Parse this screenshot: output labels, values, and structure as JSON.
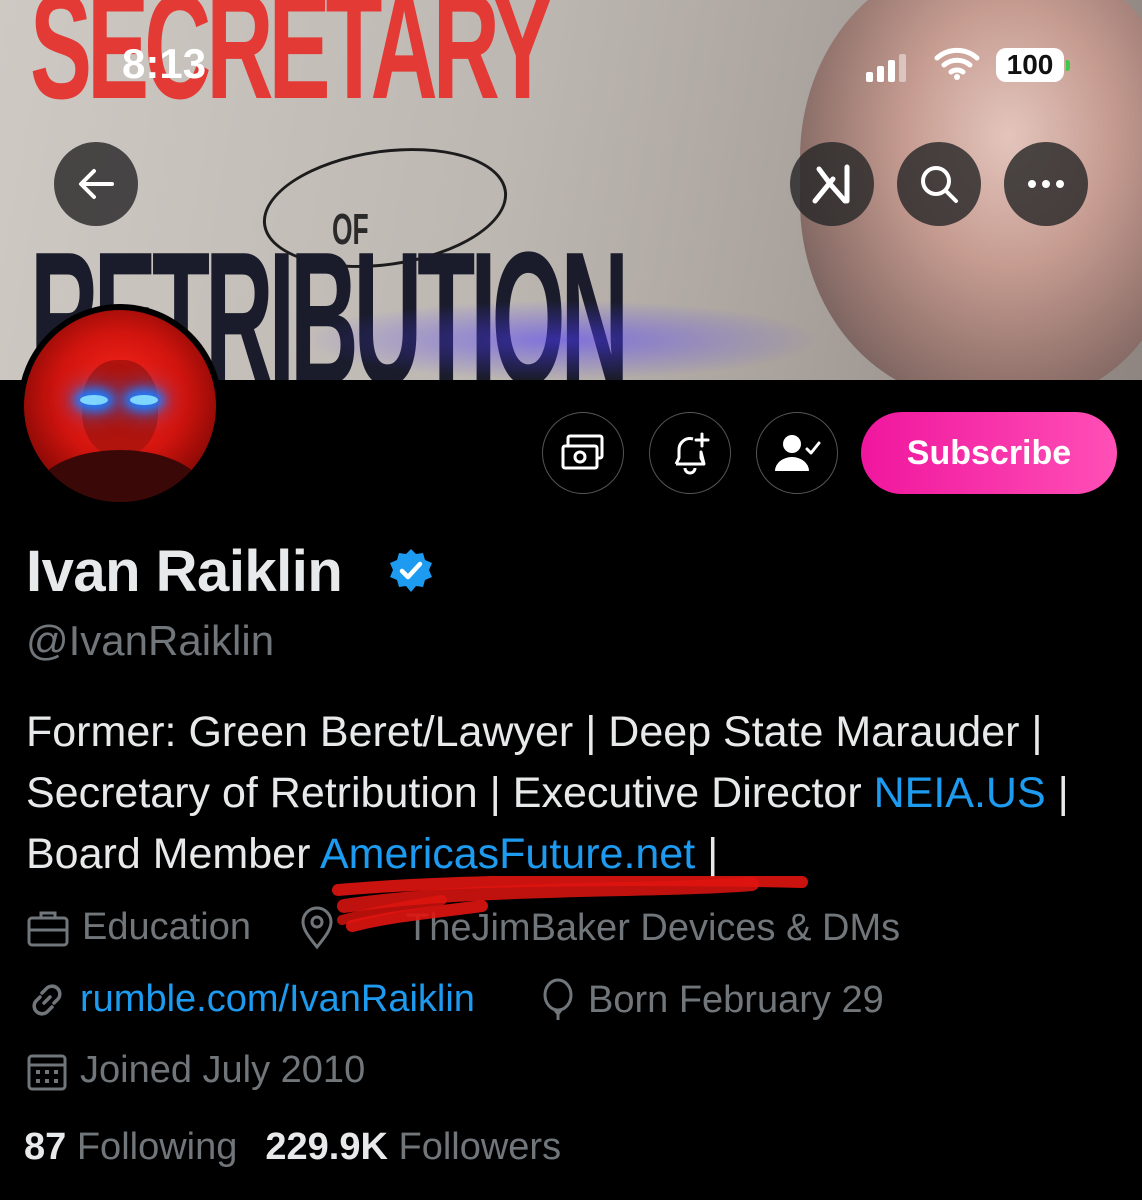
{
  "status_bar": {
    "time": "8:13",
    "battery": "100"
  },
  "banner": {
    "text_line1": "SECRETARY",
    "text_line2": "OF",
    "text_line3": "RETRIBUTION"
  },
  "profile": {
    "name": "Ivan Raiklin",
    "handle": "@IvanRaiklin",
    "subscribe_label": "Subscribe",
    "bio": {
      "line1": "Former: Green Beret/Lawyer | Deep State Marauder |",
      "line2_pre": "Secretary of Retribution | Executive Director ",
      "line2_link": "NEIA.US",
      "line2_post": " |",
      "line3_pre": "Board Member ",
      "line3_link": "AmericasFuture.net",
      "line3_post": " |"
    },
    "category": "Education",
    "location": "TheJimBaker Devices & DMs",
    "website": "rumble.com/IvanRaiklin",
    "birthday": "Born February 29",
    "joined": "Joined July 2010",
    "following_count": "87",
    "following_label": "Following",
    "followers_count": "229.9K",
    "followers_label": "Followers"
  },
  "colors": {
    "link": "#1d9bf0",
    "verified": "#1d9bf0",
    "subscribe_start": "#f0169e",
    "subscribe_end": "#ff4fb6",
    "redaction": "#e0140f"
  }
}
